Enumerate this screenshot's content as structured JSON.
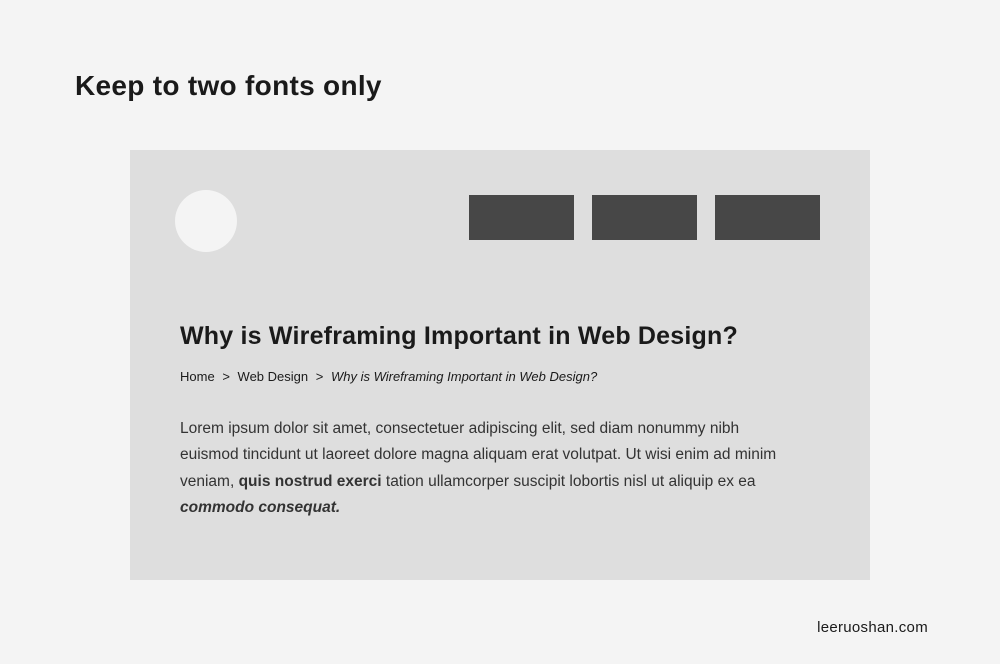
{
  "page": {
    "title": "Keep to two fonts only",
    "credit": "leeruoshan.com"
  },
  "wireframe": {
    "article_title": "Why is Wireframing Important in Web Design?",
    "breadcrumb": {
      "items": [
        "Home",
        "Web Design"
      ],
      "current": "Why is Wireframing Important in Web Design?",
      "sep": ">"
    },
    "body": {
      "p1_a": "Lorem ipsum dolor sit amet, consectetuer adipiscing elit, sed diam nonummy nibh euismod tincidunt ut laoreet dolore magna aliquam erat volutpat. Ut wisi enim ad minim veniam, ",
      "p1_bold": "quis nostrud exerci",
      "p1_b": " tation ullamcorper suscipit lobortis nisl ut aliquip ex ea ",
      "p1_bolditalic": "commodo consequat."
    }
  }
}
